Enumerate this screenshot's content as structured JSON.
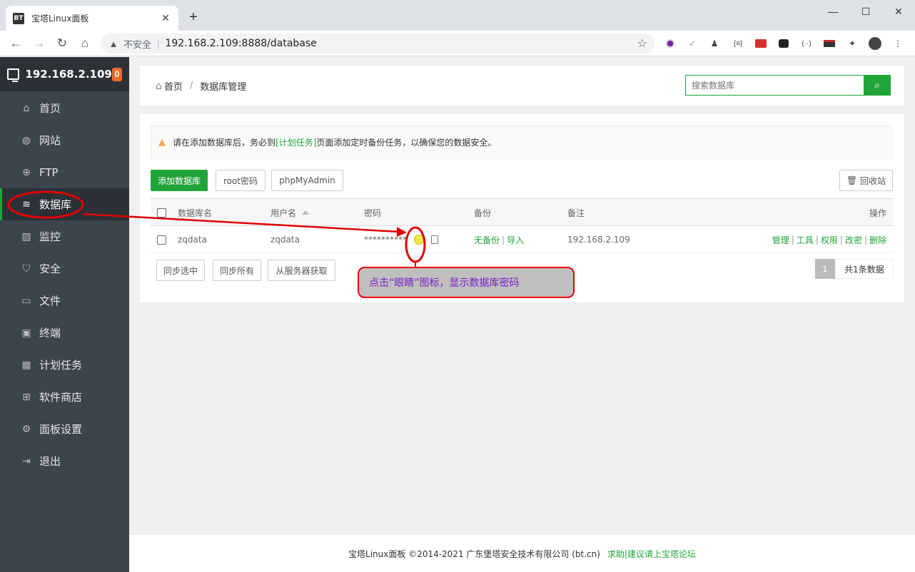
{
  "browser": {
    "tab_title": "宝塔Linux面板",
    "favicon": "BT",
    "insecure_label": "不安全",
    "url": "192.168.2.109:8888/database"
  },
  "sidebar": {
    "ip": "192.168.2.109",
    "badge": "0",
    "items": [
      {
        "label": "首页",
        "icon": "home-icon"
      },
      {
        "label": "网站",
        "icon": "globe-icon"
      },
      {
        "label": "FTP",
        "icon": "ftp-icon"
      },
      {
        "label": "数据库",
        "icon": "database-icon"
      },
      {
        "label": "监控",
        "icon": "monitor-icon"
      },
      {
        "label": "安全",
        "icon": "shield-icon"
      },
      {
        "label": "文件",
        "icon": "folder-icon"
      },
      {
        "label": "终端",
        "icon": "terminal-icon"
      },
      {
        "label": "计划任务",
        "icon": "calendar-icon"
      },
      {
        "label": "软件商店",
        "icon": "grid-icon"
      },
      {
        "label": "面板设置",
        "icon": "gear-icon"
      },
      {
        "label": "退出",
        "icon": "logout-icon"
      }
    ]
  },
  "breadcrumb": {
    "home": "首页",
    "current": "数据库管理"
  },
  "search": {
    "placeholder": "搜索数据库"
  },
  "alert": {
    "prefix": "请在添加数据库后，务必到",
    "link": "[计划任务]",
    "suffix": "页面添加定时备份任务，以确保您的数据安全。"
  },
  "toolbar": {
    "add_db": "添加数据库",
    "root_pwd": "root密码",
    "phpmyadmin": "phpMyAdmin",
    "recycle": "回收站"
  },
  "table": {
    "headers": {
      "name": "数据库名",
      "user": "用户名",
      "password": "密码",
      "backup": "备份",
      "note": "备注",
      "ops": "操作"
    },
    "rows": [
      {
        "name": "zqdata",
        "user": "zqdata",
        "password": "**********",
        "backup_none": "无备份",
        "backup_import": "导入",
        "note": "192.168.2.109",
        "op_manage": "管理",
        "op_tools": "工具",
        "op_perm": "权限",
        "op_pwd": "改密",
        "op_delete": "删除"
      }
    ]
  },
  "bottom_buttons": {
    "sync_selected": "同步选中",
    "sync_all": "同步所有",
    "fetch_server": "从服务器获取"
  },
  "pager": {
    "page": "1",
    "total": "共1条数据"
  },
  "footer": {
    "copyright": "宝塔Linux面板 ©2014-2021 广东堡塔安全技术有限公司 (bt.cn)",
    "link": "求助|建议请上宝塔论坛"
  },
  "annotation": {
    "callout": "点击“眼睛”图标，显示数据库密码",
    "color": "#e00000"
  }
}
